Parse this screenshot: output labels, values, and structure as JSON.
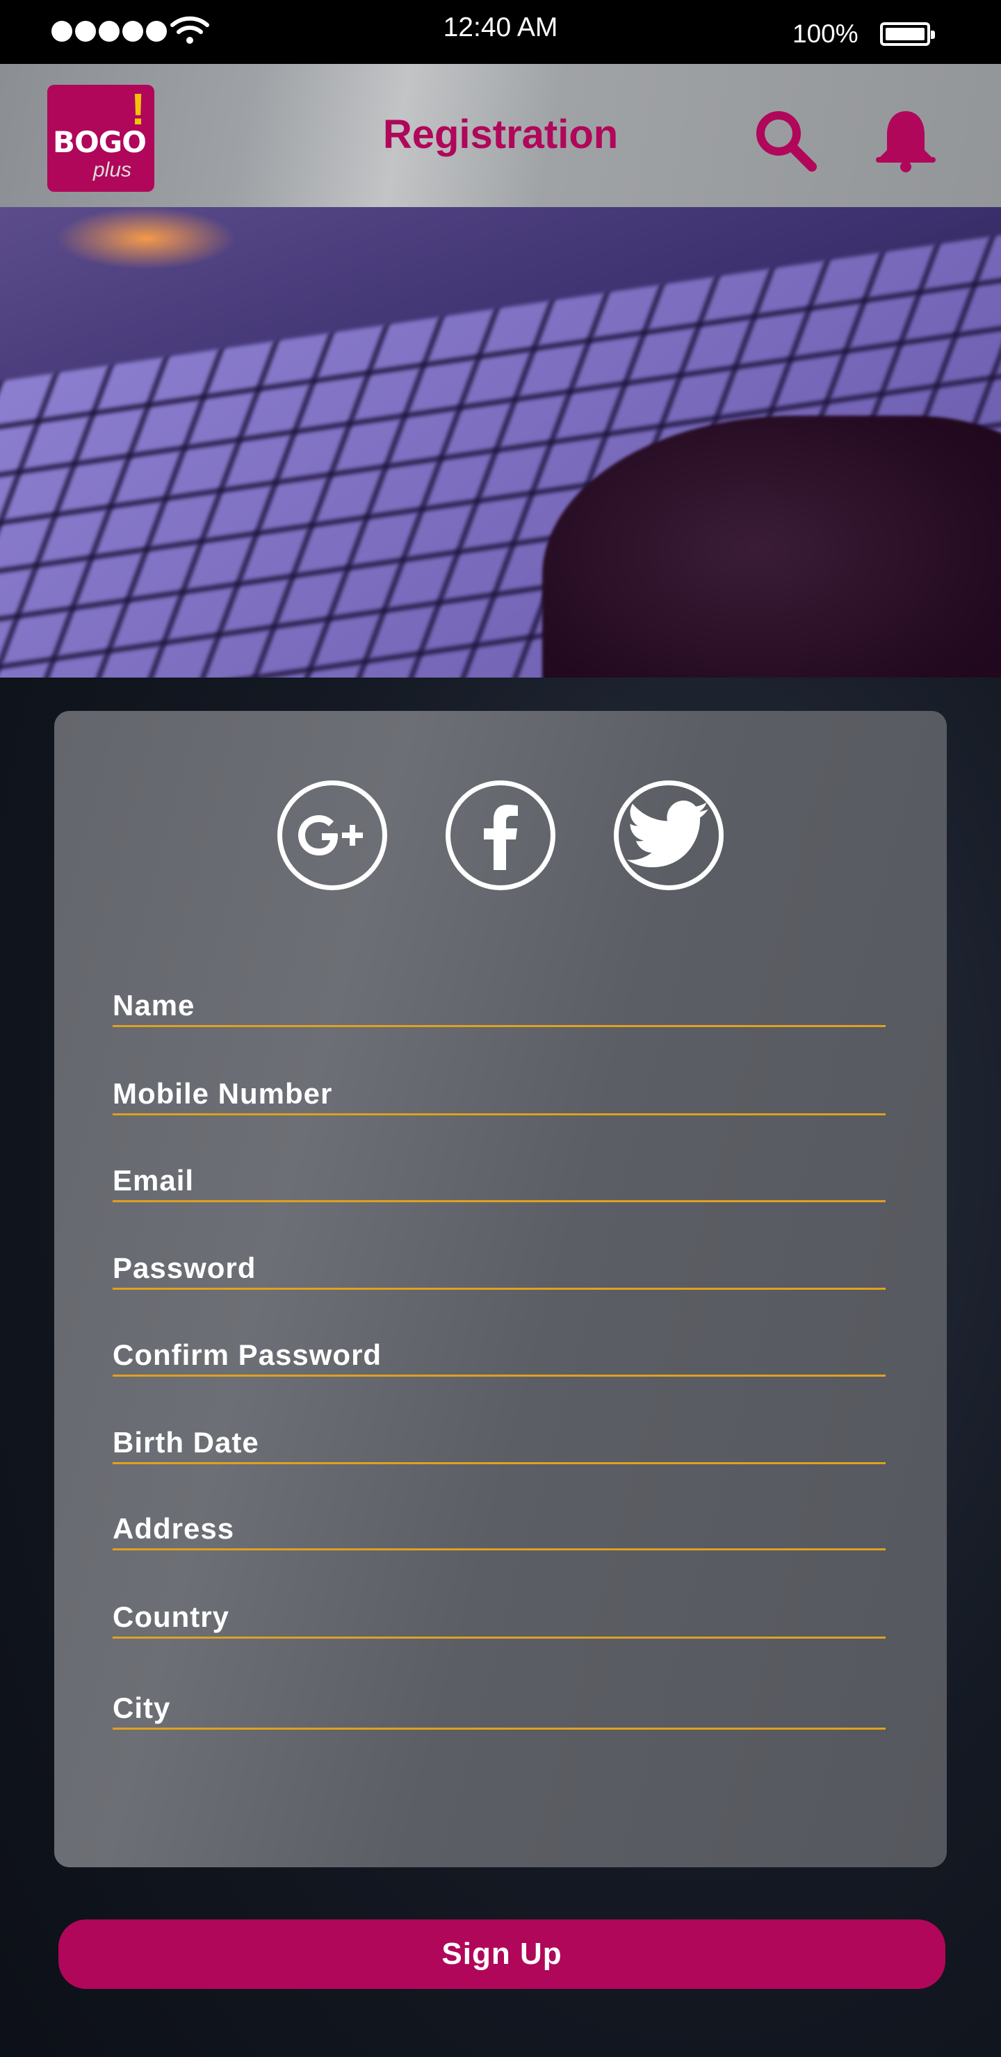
{
  "status_bar": {
    "time": "12:40 AM",
    "battery": "100%"
  },
  "app_bar": {
    "logo": {
      "word": "BOGO",
      "exclamation": "!",
      "suffix": "plus"
    },
    "title": "Registration",
    "icons": [
      "search-icon",
      "bell-icon"
    ]
  },
  "social": [
    "google-plus-icon",
    "facebook-icon",
    "twitter-icon"
  ],
  "form": {
    "fields": [
      {
        "label": "Name"
      },
      {
        "label": "Mobile Number"
      },
      {
        "label": "Email"
      },
      {
        "label": "Password"
      },
      {
        "label": "Confirm Password"
      },
      {
        "label": "Birth Date"
      },
      {
        "label": "Address"
      },
      {
        "label": "Country"
      },
      {
        "label": "City"
      }
    ]
  },
  "signup_label": "Sign Up",
  "colors": {
    "brand": "#b0075a",
    "underline": "#e0a020",
    "card": "#63666c"
  }
}
